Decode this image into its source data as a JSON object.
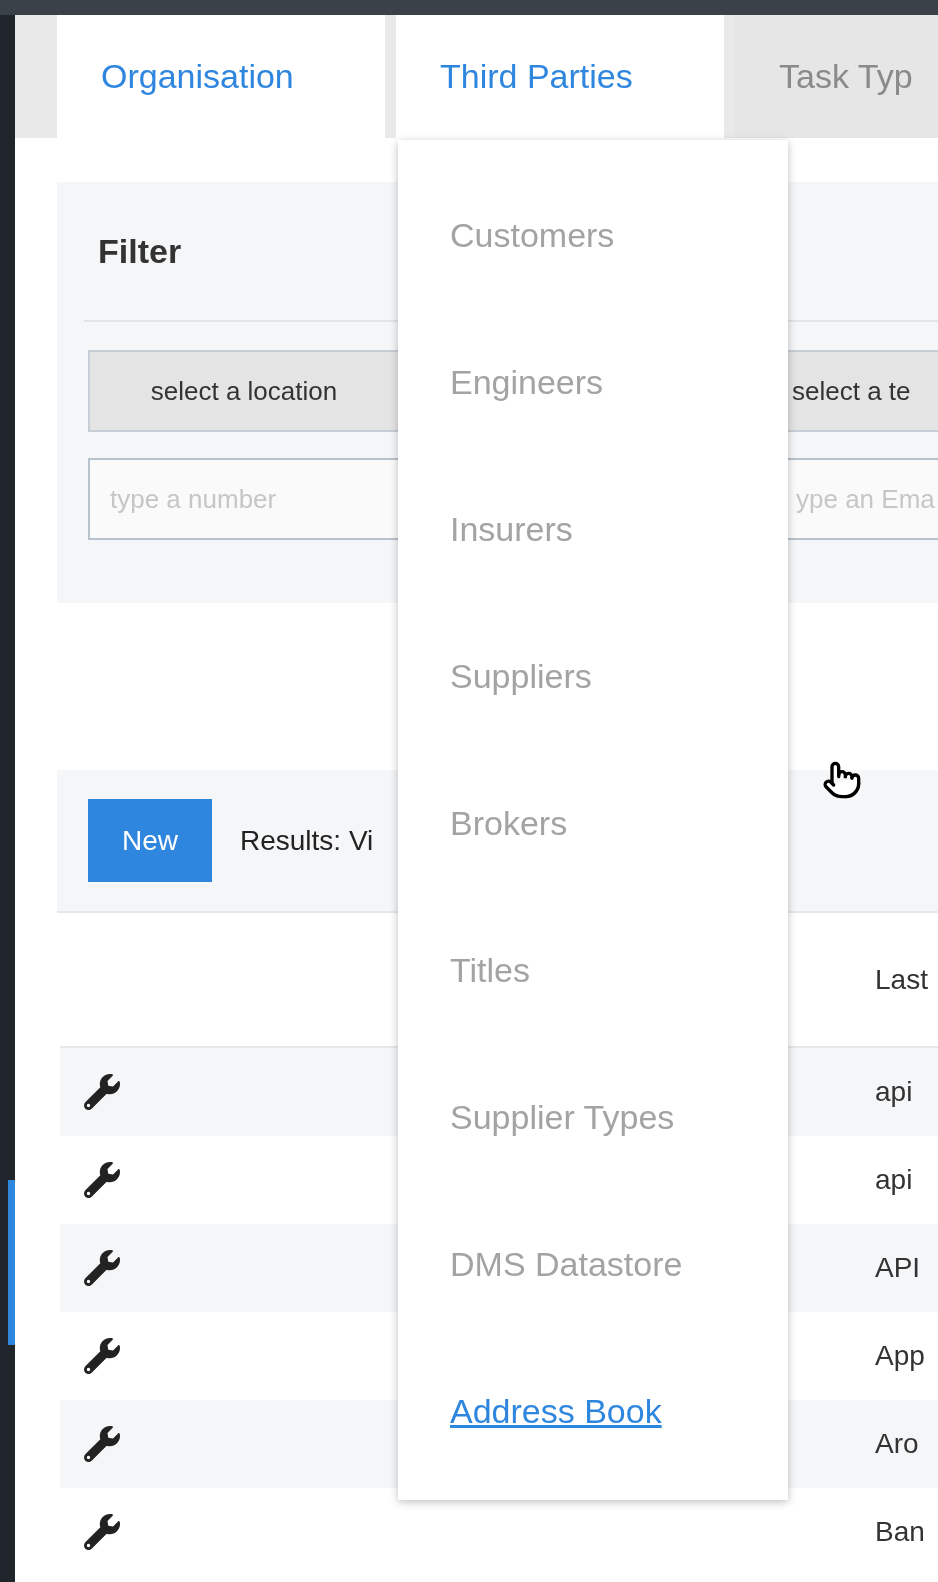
{
  "tabs": [
    {
      "label": "Organisation",
      "highlighted": true
    },
    {
      "label": "Third Parties",
      "highlighted": true
    },
    {
      "label": "Task Typ",
      "highlighted": false
    }
  ],
  "dropdown": {
    "items": [
      {
        "label": "Customers",
        "highlighted": false
      },
      {
        "label": "Engineers",
        "highlighted": false
      },
      {
        "label": "Insurers",
        "highlighted": false
      },
      {
        "label": "Suppliers",
        "highlighted": false
      },
      {
        "label": "Brokers",
        "highlighted": false
      },
      {
        "label": "Titles",
        "highlighted": false
      },
      {
        "label": "Supplier Types",
        "highlighted": false
      },
      {
        "label": "DMS Datastore",
        "highlighted": false
      },
      {
        "label": "Address Book",
        "highlighted": true
      }
    ]
  },
  "filter": {
    "title": "Filter",
    "location_select": "select a location",
    "number_field": {
      "placeholder": "type a number"
    },
    "team_select": "select a te",
    "email_field": {
      "placeholder": "ype an Ema"
    }
  },
  "results": {
    "new_button": "New",
    "summary": "Results: Vi",
    "columns": [
      {
        "label": "Last"
      }
    ],
    "rows": [
      {
        "cells": [
          "api"
        ]
      },
      {
        "cells": [
          "api"
        ]
      },
      {
        "cells": [
          "API"
        ]
      },
      {
        "cells": [
          "App"
        ]
      },
      {
        "cells": [
          "Aro"
        ]
      },
      {
        "cells": [
          "Ban"
        ]
      }
    ]
  }
}
